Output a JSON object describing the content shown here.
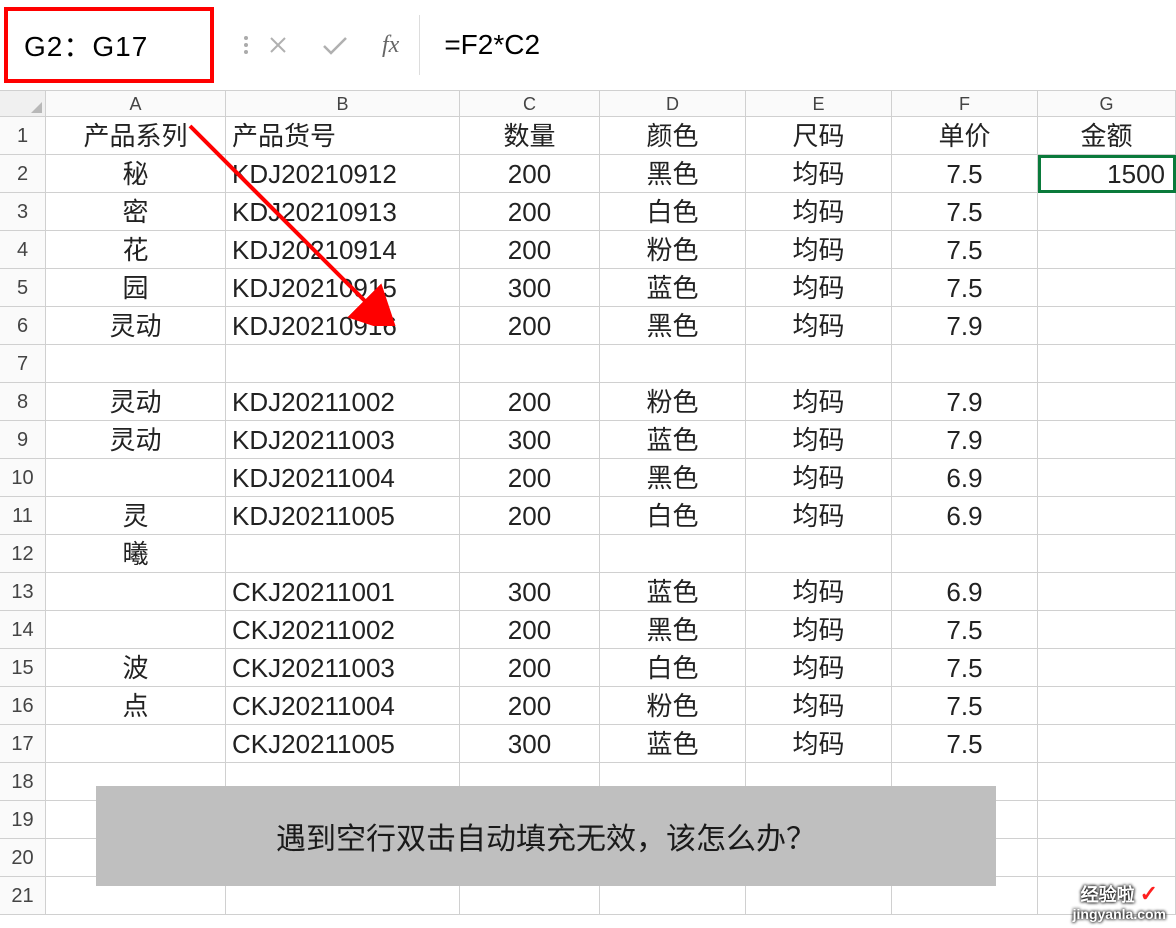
{
  "name_box": "G2：G17",
  "formula": "=F2*C2",
  "fx_label": "fx",
  "columns": [
    "A",
    "B",
    "C",
    "D",
    "E",
    "F",
    "G"
  ],
  "headers": {
    "A": "产品系列",
    "B": "产品货号",
    "C": "数量",
    "D": "颜色",
    "E": "尺码",
    "F": "单价",
    "G": "金额"
  },
  "rows": [
    {
      "n": "1",
      "A": "产品系列",
      "B": "产品货号",
      "C": "数量",
      "D": "颜色",
      "E": "尺码",
      "F": "单价",
      "G": "金额"
    },
    {
      "n": "2",
      "A": "秘",
      "B": "KDJ20210912",
      "C": "200",
      "D": "黑色",
      "E": "均码",
      "F": "7.5",
      "G": "1500"
    },
    {
      "n": "3",
      "A": "密",
      "B": "KDJ20210913",
      "C": "200",
      "D": "白色",
      "E": "均码",
      "F": "7.5",
      "G": ""
    },
    {
      "n": "4",
      "A": "花",
      "B": "KDJ20210914",
      "C": "200",
      "D": "粉色",
      "E": "均码",
      "F": "7.5",
      "G": ""
    },
    {
      "n": "5",
      "A": "园",
      "B": "KDJ20210915",
      "C": "300",
      "D": "蓝色",
      "E": "均码",
      "F": "7.5",
      "G": ""
    },
    {
      "n": "6",
      "A": "灵动",
      "B": "KDJ20210916",
      "C": "200",
      "D": "黑色",
      "E": "均码",
      "F": "7.9",
      "G": ""
    },
    {
      "n": "7",
      "A": "",
      "B": "",
      "C": "",
      "D": "",
      "E": "",
      "F": "",
      "G": ""
    },
    {
      "n": "8",
      "A": "灵动",
      "B": "KDJ20211002",
      "C": "200",
      "D": "粉色",
      "E": "均码",
      "F": "7.9",
      "G": ""
    },
    {
      "n": "9",
      "A": "灵动",
      "B": "KDJ20211003",
      "C": "300",
      "D": "蓝色",
      "E": "均码",
      "F": "7.9",
      "G": ""
    },
    {
      "n": "10",
      "A": "",
      "B": "KDJ20211004",
      "C": "200",
      "D": "黑色",
      "E": "均码",
      "F": "6.9",
      "G": ""
    },
    {
      "n": "11",
      "A": "灵",
      "B": "KDJ20211005",
      "C": "200",
      "D": "白色",
      "E": "均码",
      "F": "6.9",
      "G": ""
    },
    {
      "n": "12",
      "A": "曦",
      "B": "",
      "C": "",
      "D": "",
      "E": "",
      "F": "",
      "G": ""
    },
    {
      "n": "13",
      "A": "",
      "B": "CKJ20211001",
      "C": "300",
      "D": "蓝色",
      "E": "均码",
      "F": "6.9",
      "G": ""
    },
    {
      "n": "14",
      "A": "",
      "B": "CKJ20211002",
      "C": "200",
      "D": "黑色",
      "E": "均码",
      "F": "7.5",
      "G": ""
    },
    {
      "n": "15",
      "A": "波",
      "B": "CKJ20211003",
      "C": "200",
      "D": "白色",
      "E": "均码",
      "F": "7.5",
      "G": ""
    },
    {
      "n": "16",
      "A": "点",
      "B": "CKJ20211004",
      "C": "200",
      "D": "粉色",
      "E": "均码",
      "F": "7.5",
      "G": ""
    },
    {
      "n": "17",
      "A": "",
      "B": "CKJ20211005",
      "C": "300",
      "D": "蓝色",
      "E": "均码",
      "F": "7.5",
      "G": ""
    },
    {
      "n": "18",
      "A": "",
      "B": "",
      "C": "",
      "D": "",
      "E": "",
      "F": "",
      "G": ""
    },
    {
      "n": "19",
      "A": "",
      "B": "",
      "C": "",
      "D": "",
      "E": "",
      "F": "",
      "G": ""
    },
    {
      "n": "20",
      "A": "",
      "B": "",
      "C": "",
      "D": "",
      "E": "",
      "F": "",
      "G": ""
    },
    {
      "n": "21",
      "A": "",
      "B": "",
      "C": "",
      "D": "",
      "E": "",
      "F": "",
      "G": ""
    }
  ],
  "active_cell": "G2",
  "banner_text": "遇到空行双击自动填充无效，该怎么办？",
  "watermark": {
    "top": "经验啦",
    "bottom": "jingyanla.com",
    "check": "✓"
  }
}
